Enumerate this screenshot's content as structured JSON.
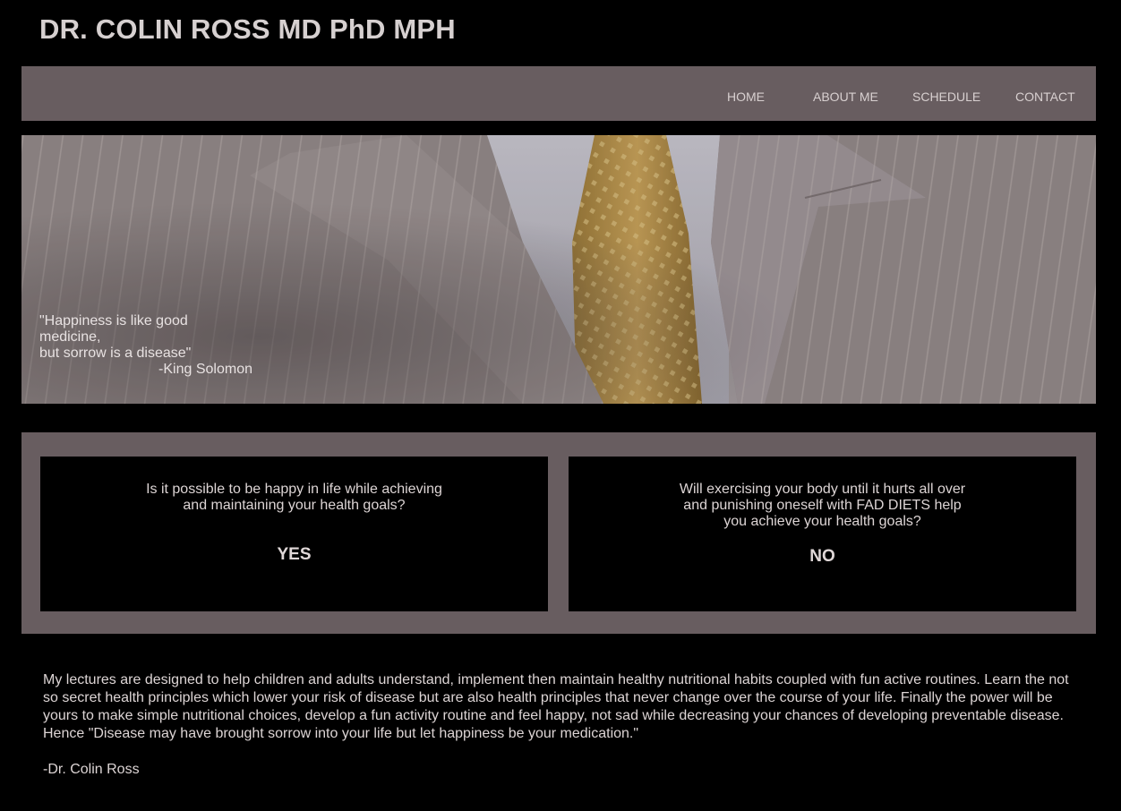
{
  "site": {
    "title": "DR. COLIN ROSS MD PhD MPH"
  },
  "nav": {
    "items": [
      {
        "label": "HOME"
      },
      {
        "label": "ABOUT ME"
      },
      {
        "label": "SCHEDULE"
      },
      {
        "label": "CONTACT"
      }
    ]
  },
  "hero": {
    "quote_line1": "\"Happiness is like good medicine,",
    "quote_line2": "but sorrow is a disease\"",
    "quote_author": "-King Solomon"
  },
  "questions": [
    {
      "text": "Is it possible to be happy in life while achieving and maintaining your health goals?",
      "answer": "YES"
    },
    {
      "text": "Will exercising your body until it hurts all over and punishing oneself with FAD DIETS help you achieve your health goals?",
      "answer": "NO"
    }
  ],
  "bio": {
    "paragraph": "My lectures are designed to help children and adults understand, implement then maintain healthy nutritional habits coupled with fun active routines. Learn the not so secret health principles which lower your risk of disease but are also health principles that never change over the course of your life. Finally the power will be yours to make simple nutritional choices, develop a fun activity routine and feel happy, not sad while decreasing your chances of developing preventable disease. Hence \"Disease may have brought sorrow into your life but let happiness be your medication.\"",
    "signature": "-Dr. Colin Ross"
  },
  "colors": {
    "background": "#000000",
    "panel": "#685d60",
    "text": "#d9d2d2"
  }
}
